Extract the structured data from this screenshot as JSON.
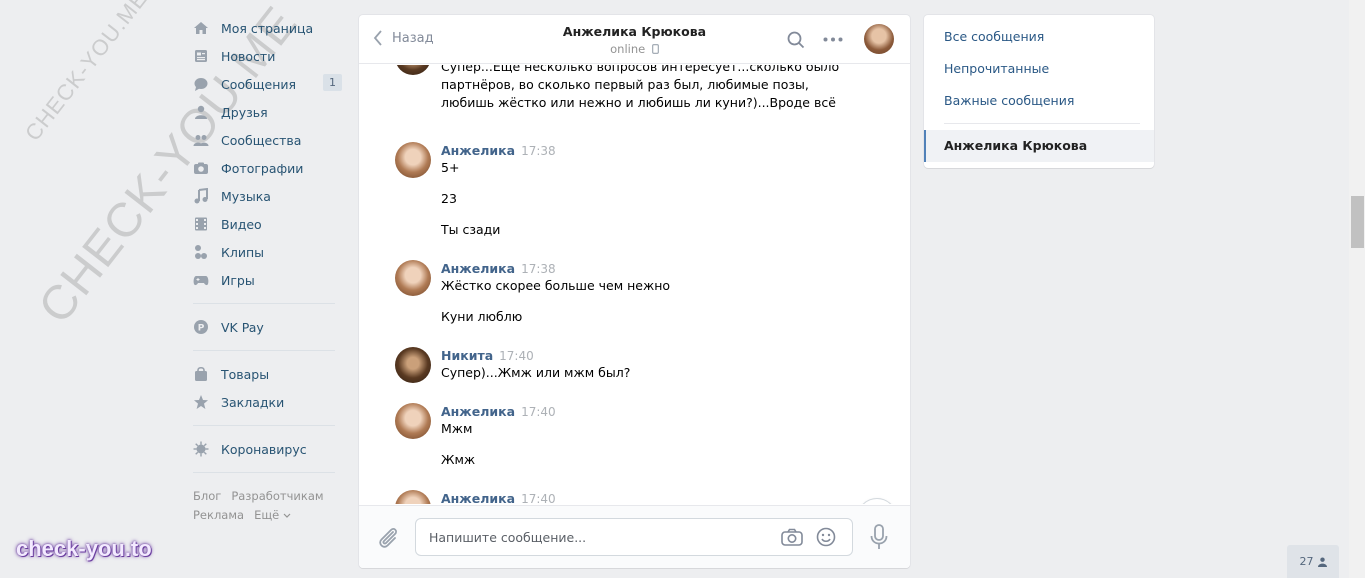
{
  "watermark": {
    "small": "CHECK-YOU.ME",
    "large": "CHECK-YOU.ME",
    "brand": "check-you.to"
  },
  "left_menu": {
    "items": [
      {
        "label": "Моя страница",
        "icon": "home-icon"
      },
      {
        "label": "Новости",
        "icon": "news-icon"
      },
      {
        "label": "Сообщения",
        "icon": "messages-icon",
        "count": "1"
      },
      {
        "label": "Друзья",
        "icon": "friends-icon"
      },
      {
        "label": "Сообщества",
        "icon": "groups-icon"
      },
      {
        "label": "Фотографии",
        "icon": "camera-icon"
      },
      {
        "label": "Музыка",
        "icon": "music-icon"
      },
      {
        "label": "Видео",
        "icon": "video-icon"
      },
      {
        "label": "Клипы",
        "icon": "clips-icon"
      },
      {
        "label": "Игры",
        "icon": "gamepad-icon"
      },
      {
        "label": "VK Pay",
        "icon": "vkpay-icon"
      },
      {
        "label": "Товары",
        "icon": "bag-icon"
      },
      {
        "label": "Закладки",
        "icon": "star-icon"
      },
      {
        "label": "Коронавирус",
        "icon": "virus-icon"
      }
    ],
    "footer": [
      "Блог",
      "Разработчикам",
      "Реклама",
      "Ещё"
    ]
  },
  "chat": {
    "back_label": "Назад",
    "title": "Анжелика Крюкова",
    "status": "online",
    "messages": [
      {
        "lines": [
          "Супер...Еще несколько вопросов интересует...сколько было",
          "партнёров, во сколько первый раз был, любимые позы,",
          "любишь жёстко или нежно и любишь ли куни?)...Вроде всё"
        ]
      },
      {
        "author": "Анжелика",
        "time": "17:38",
        "lines": [
          "5+",
          "23",
          "Ты сзади"
        ]
      },
      {
        "author": "Анжелика",
        "time": "17:38",
        "lines": [
          "Жёстко скорее больше чем нежно",
          "Куни люблю"
        ]
      },
      {
        "author": "Никита",
        "time": "17:40",
        "lines": [
          "Супер)...Жмж или мжм был?"
        ]
      },
      {
        "author": "Анжелика",
        "time": "17:40",
        "lines": [
          "Мжм",
          "Жмж"
        ]
      },
      {
        "author": "Анжелика",
        "time": "17:40",
        "lines": []
      }
    ],
    "composer_placeholder": "Напишите сообщение..."
  },
  "right_panel": {
    "items": [
      "Все сообщения",
      "Непрочитанные",
      "Важные сообщения"
    ],
    "selected": "Анжелика Крюкова"
  },
  "online_count": "27"
}
